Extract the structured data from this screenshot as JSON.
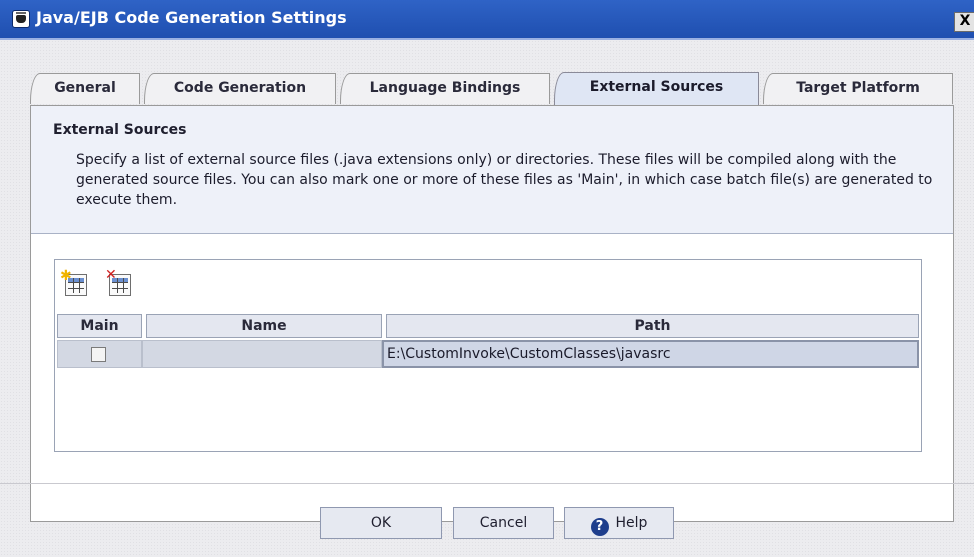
{
  "window": {
    "title": "Java/EJB Code Generation Settings",
    "close_glyph": "X"
  },
  "tabs": [
    {
      "label": "General"
    },
    {
      "label": "Code Generation"
    },
    {
      "label": "Language Bindings"
    },
    {
      "label": "External Sources",
      "active": true
    },
    {
      "label": "Target Platform"
    }
  ],
  "section": {
    "title": "External Sources",
    "description": "Specify a list of external source files (.java extensions only) or directories. These files will be compiled along with the generated source files. You can also mark one or more of these files as 'Main', in which case batch file(s) are generated to execute them."
  },
  "toolbar": {
    "add_icon": "add-row-icon",
    "remove_icon": "remove-row-icon"
  },
  "table": {
    "columns": [
      "Main",
      "Name",
      "Path"
    ],
    "rows": [
      {
        "main": false,
        "name": "",
        "path": "E:\\CustomInvoke\\CustomClasses\\javasrc"
      }
    ]
  },
  "buttons": {
    "ok": "OK",
    "cancel": "Cancel",
    "help": "Help",
    "help_glyph": "?"
  }
}
